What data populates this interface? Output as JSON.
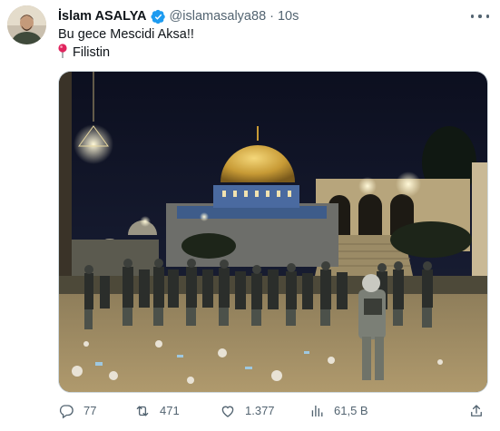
{
  "tweet": {
    "author_name": "İslam ASALYA",
    "handle": "@islamasalya88",
    "separator": "·",
    "time": "10s",
    "text_line1": "Bu gece Mescidi Aksa!!",
    "text_line2": "Filistin",
    "location_icon": "round-pushpin-icon"
  },
  "actions": {
    "replies": "77",
    "retweets": "471",
    "likes": "1.377",
    "views": "61,5 B"
  },
  "colors": {
    "verified": "#1d9bf0",
    "secondary_text": "#536471",
    "pin": "#e0245e"
  }
}
